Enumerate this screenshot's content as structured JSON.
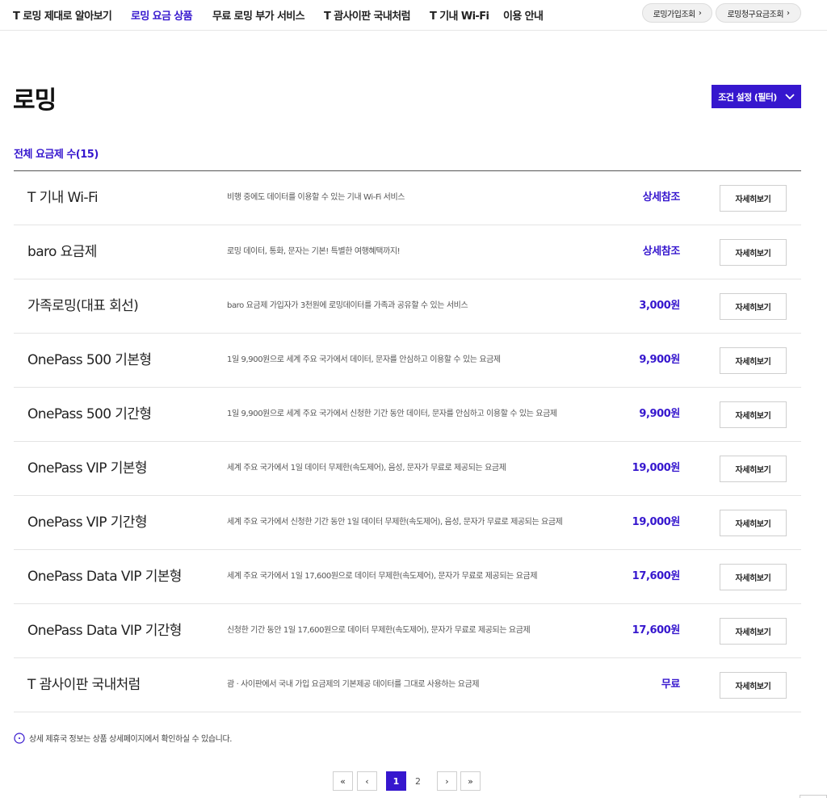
{
  "nav": {
    "items": [
      {
        "label": "T 로밍 제대로 알아보기",
        "active": false
      },
      {
        "label": "로밍 요금 상품",
        "active": true
      },
      {
        "label": "무료 로밍 부가 서비스",
        "active": false
      },
      {
        "label": "T 괌사이판 국내처럼",
        "active": false
      },
      {
        "label": "T 기내 Wi-Fi",
        "active": false
      },
      {
        "label": "이용 안내",
        "active": false
      }
    ],
    "quick_links": [
      {
        "label": "로밍가입조회"
      },
      {
        "label": "로밍청구요금조회"
      }
    ]
  },
  "page": {
    "title": "로밍",
    "filter_label": "조건 설정 (필터)",
    "count_label": "전체 요금제 수(15)"
  },
  "plans": [
    {
      "name": "T 기내 Wi-Fi",
      "desc": "비행 중에도 데이터를 이용할 수 있는 기내 Wi-Fi 서비스",
      "price": "상세참조",
      "button": "자세히보기"
    },
    {
      "name": "baro 요금제",
      "desc": "로밍 데이터, 통화, 문자는 기본! 특별한 여행혜택까지!",
      "price": "상세참조",
      "button": "자세히보기"
    },
    {
      "name": "가족로밍(대표 회선)",
      "desc": "baro 요금제 가입자가 3천원에 로밍데이터를 가족과 공유할 수 있는 서비스",
      "price": "3,000원",
      "button": "자세히보기"
    },
    {
      "name": "OnePass 500 기본형",
      "desc": "1일 9,900원으로 세계 주요 국가에서 데이터, 문자를 안심하고 이용할 수 있는 요금제",
      "price": "9,900원",
      "button": "자세히보기"
    },
    {
      "name": "OnePass 500 기간형",
      "desc": "1일 9,900원으로 세계 주요 국가에서 신청한 기간 동안 데이터, 문자를 안심하고 이용할 수 있는 요금제",
      "price": "9,900원",
      "button": "자세히보기"
    },
    {
      "name": "OnePass VIP 기본형",
      "desc": "세계 주요 국가에서 1일 데이터 무제한(속도제어), 음성, 문자가 무료로 제공되는 요금제",
      "price": "19,000원",
      "button": "자세히보기"
    },
    {
      "name": "OnePass VIP 기간형",
      "desc": "세계 주요 국가에서 신청한 기간 동안 1일 데이터 무제한(속도제어), 음성, 문자가 무료로 제공되는 요금제",
      "price": "19,000원",
      "button": "자세히보기"
    },
    {
      "name": "OnePass Data VIP 기본형",
      "desc": "세계 주요 국가에서 1일 17,600원으로 데이터 무제한(속도제어), 문자가 무료로 제공되는 요금제",
      "price": "17,600원",
      "button": "자세히보기"
    },
    {
      "name": "OnePass Data VIP 기간형",
      "desc": "신청한 기간 동안 1일 17,600원으로 데이터 무제한(속도제어), 문자가 무료로 제공되는 요금제",
      "price": "17,600원",
      "button": "자세히보기"
    },
    {
      "name": "T 괌사이판 국내처럼",
      "desc": "괌 · 사이판에서 국내 가입 요금제의 기본제공 데이터를 그대로 사용하는 요금제",
      "price": "무료",
      "button": "자세히보기"
    }
  ],
  "notice": {
    "text": "상세 제휴국 정보는 상품 상세페이지에서 확인하실 수 있습니다.",
    "icon": "info-circle-icon"
  },
  "pagination": {
    "first": "«",
    "prev": "‹",
    "pages": [
      "1",
      "2"
    ],
    "current": "1",
    "next": "›",
    "last": "»"
  },
  "colors": {
    "accent": "#3617ce",
    "text": "#222222",
    "divider": "#e4e4e4"
  }
}
